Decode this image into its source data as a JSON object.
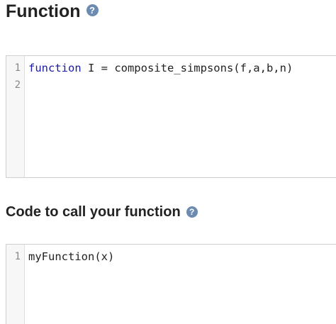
{
  "function_section": {
    "title": "Function",
    "help_icon": "?",
    "editor": {
      "line_numbers": [
        "1",
        "2"
      ],
      "line1_keyword": "function",
      "line1_rest": " I = composite_simpsons(f,a,b,n)",
      "line2": ""
    }
  },
  "call_section": {
    "title": "Code to call your function",
    "help_icon": "?",
    "editor": {
      "line_numbers": [
        "1"
      ],
      "line1": "myFunction(x)"
    }
  },
  "colors": {
    "keyword": "#1a1aa6",
    "help_icon_bg": "#6b8bb0",
    "gutter_bg": "#f7f7f7",
    "border": "#cfcfcf"
  },
  "icons": {
    "help": "help-circle-icon"
  }
}
